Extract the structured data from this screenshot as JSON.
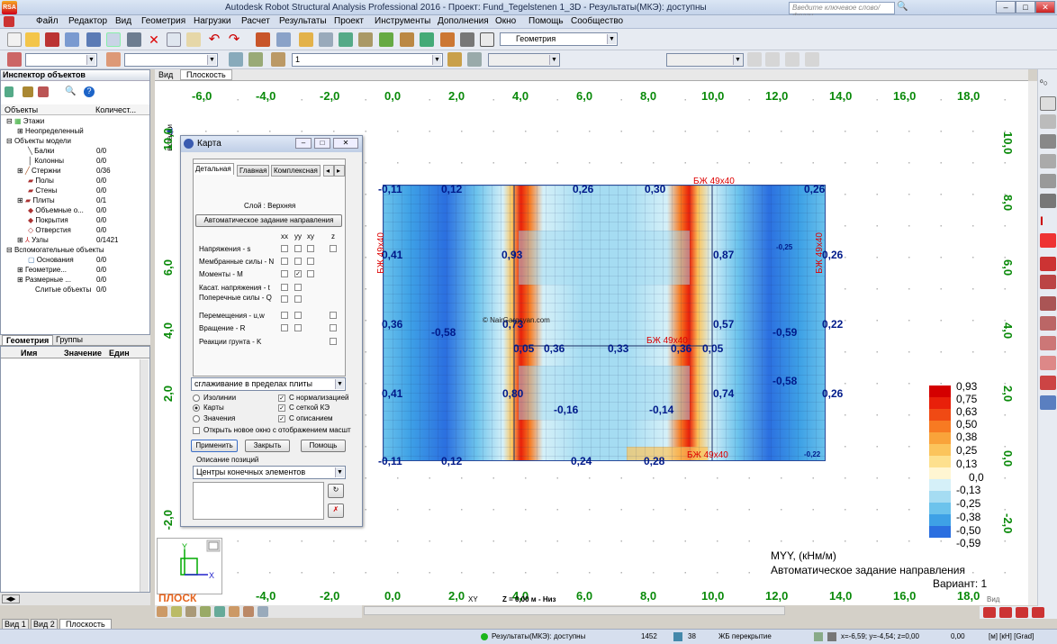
{
  "window": {
    "title": "Autodesk Robot Structural Analysis Professional 2016 - Проект: Fund_Tegelstenen 1_3D - Результаты(МКЭ): доступны",
    "app_icon": "RSA",
    "search_placeholder": "Введите ключевое слово/фразу"
  },
  "menu": [
    "Файл",
    "Редактор",
    "Вид",
    "Геометрия",
    "Нагрузки",
    "Расчет",
    "Результаты",
    "Проект",
    "Инструменты",
    "Дополнения",
    "Окно",
    "Помощь",
    "Сообщество"
  ],
  "toolbar": {
    "geometry_layout": "Геометрия",
    "case_value": "1"
  },
  "inspector": {
    "title": "Инспектор объектов",
    "col_objects": "Объекты",
    "col_count": "Количест...",
    "tree": [
      {
        "label": "Этажи",
        "count": ""
      },
      {
        "label": "Неопределенный",
        "count": ""
      },
      {
        "label": "Объекты модели",
        "count": ""
      },
      {
        "label": "Балки",
        "count": "0/0"
      },
      {
        "label": "Колонны",
        "count": "0/0"
      },
      {
        "label": "Стержни",
        "count": "0/36"
      },
      {
        "label": "Полы",
        "count": "0/0"
      },
      {
        "label": "Стены",
        "count": "0/0"
      },
      {
        "label": "Плиты",
        "count": "0/1"
      },
      {
        "label": "Объемные о...",
        "count": "0/0"
      },
      {
        "label": "Покрытия",
        "count": "0/0"
      },
      {
        "label": "Отверстия",
        "count": "0/0"
      },
      {
        "label": "Узлы",
        "count": "0/1421"
      },
      {
        "label": "Вспомогательные объекты",
        "count": ""
      },
      {
        "label": "Основания",
        "count": "0/0"
      },
      {
        "label": "Геометрие...",
        "count": "0/0"
      },
      {
        "label": "Размерные ...",
        "count": "0/0"
      },
      {
        "label": "Слитые объекты",
        "count": "0/0"
      }
    ],
    "tabs": [
      "Геометрия",
      "Группы"
    ]
  },
  "propgrid": {
    "cols": [
      "Имя",
      "Значение",
      "Един"
    ]
  },
  "view_tabs": [
    "Вид",
    "Плоскость"
  ],
  "canvas": {
    "x_ticks": [
      "-6,0",
      "-4,0",
      "-2,0",
      "0,0",
      "2,0",
      "4,0",
      "6,0",
      "8,0",
      "10,0",
      "12,0",
      "14,0",
      "16,0",
      "18,0"
    ],
    "y_ticks": [
      "10,0",
      "8,0",
      "6,0",
      "4,0",
      "2,0",
      "0,0",
      "-2,0"
    ],
    "side_label": "вкладки",
    "watermark": "© NairGargsyan.com",
    "beam_labels": [
      "БЖ 49x40",
      "БЖ 49x40",
      "БЖ 49x40",
      "БЖ 49x40",
      "БЖ 49x40"
    ],
    "edge_values": [
      "-0,11",
      "0,12",
      "0,26",
      "0,30",
      "0,26",
      "0,41",
      "0,93",
      "0,87",
      "0,26",
      "0,36",
      "-0,58",
      "0,73",
      "0,05",
      "0,36",
      "0,33",
      "0,36",
      "0,05",
      "0,57",
      "-0,59",
      "0,22",
      "0,41",
      "0,80",
      "-0,16",
      "-0,14",
      "0,74",
      "-0,58",
      "0,26",
      "-0,11",
      "0,12",
      "0,24",
      "0,28",
      "-0,22",
      "-0,25"
    ],
    "info_title": "MYY, (кНм/м)",
    "info_sub": "Автоматическое задание направления",
    "info_case": "Вариант: 1",
    "bottom_label": "ПЛОСК",
    "bottom_coord": "Z = 0,00 м - Низ",
    "bottom_xy": "XY",
    "bottom_view": "Вид"
  },
  "legend": {
    "entries": [
      {
        "label": "0,93",
        "color": "#d40000"
      },
      {
        "label": "0,75",
        "color": "#e8200a"
      },
      {
        "label": "0,63",
        "color": "#f04a14"
      },
      {
        "label": "0,50",
        "color": "#f77a22"
      },
      {
        "label": "0,38",
        "color": "#f9a33a"
      },
      {
        "label": "0,25",
        "color": "#fbc45c"
      },
      {
        "label": "0,13",
        "color": "#fde08e"
      },
      {
        "label": "0,0",
        "color": "#fff6d2"
      },
      {
        "label": "-0,13",
        "color": "#d5f0f8"
      },
      {
        "label": "-0,25",
        "color": "#a5dcf2"
      },
      {
        "label": "-0,38",
        "color": "#6cc3ec"
      },
      {
        "label": "-0,50",
        "color": "#3ea1e6"
      },
      {
        "label": "-0,59",
        "color": "#2b6fe0"
      }
    ]
  },
  "dialog": {
    "title": "Карта",
    "tabs": [
      "Детальная",
      "Главная",
      "Комплексная"
    ],
    "layer": "Слой : Верхняя",
    "auto_btn": "Автоматическое задание направления",
    "cols": [
      "xx",
      "yy",
      "xy",
      "z"
    ],
    "rows": [
      "Напряжения - s",
      "Мембранные силы - N",
      "Моменты - M",
      "Касат. напряжения - t",
      "Поперечные силы - Q",
      "Перемещения - u,w",
      "Вращение - R",
      "Реакции грунта - K"
    ],
    "smoothing": "сглаживание в пределах плиты",
    "opt_iso": "Изолинии",
    "opt_map": "Карты",
    "opt_values": "Значения",
    "chk_norm": "С нормализацией",
    "chk_mesh": "С сеткой КЭ",
    "chk_desc": "С описанием",
    "chk_newwin": "Открыть новое окно с отображением масшт",
    "btn_apply": "Применить",
    "btn_close": "Закрыть",
    "btn_help": "Помощь",
    "pos_label": "Описание позиций",
    "pos_value": "Центры конечных элементов"
  },
  "bottom_tabs": [
    "Вид 1",
    "Вид 2",
    "Плоскость"
  ],
  "status": {
    "results": "Результаты(МКЭ): доступны",
    "num1": "1452",
    "num2": "38",
    "section": "ЖБ перекрытие",
    "coords": "x=-6,59; y=-4,54; z=0,00",
    "zero": "0,00",
    "units": "[м] [кН] [Grad]"
  }
}
